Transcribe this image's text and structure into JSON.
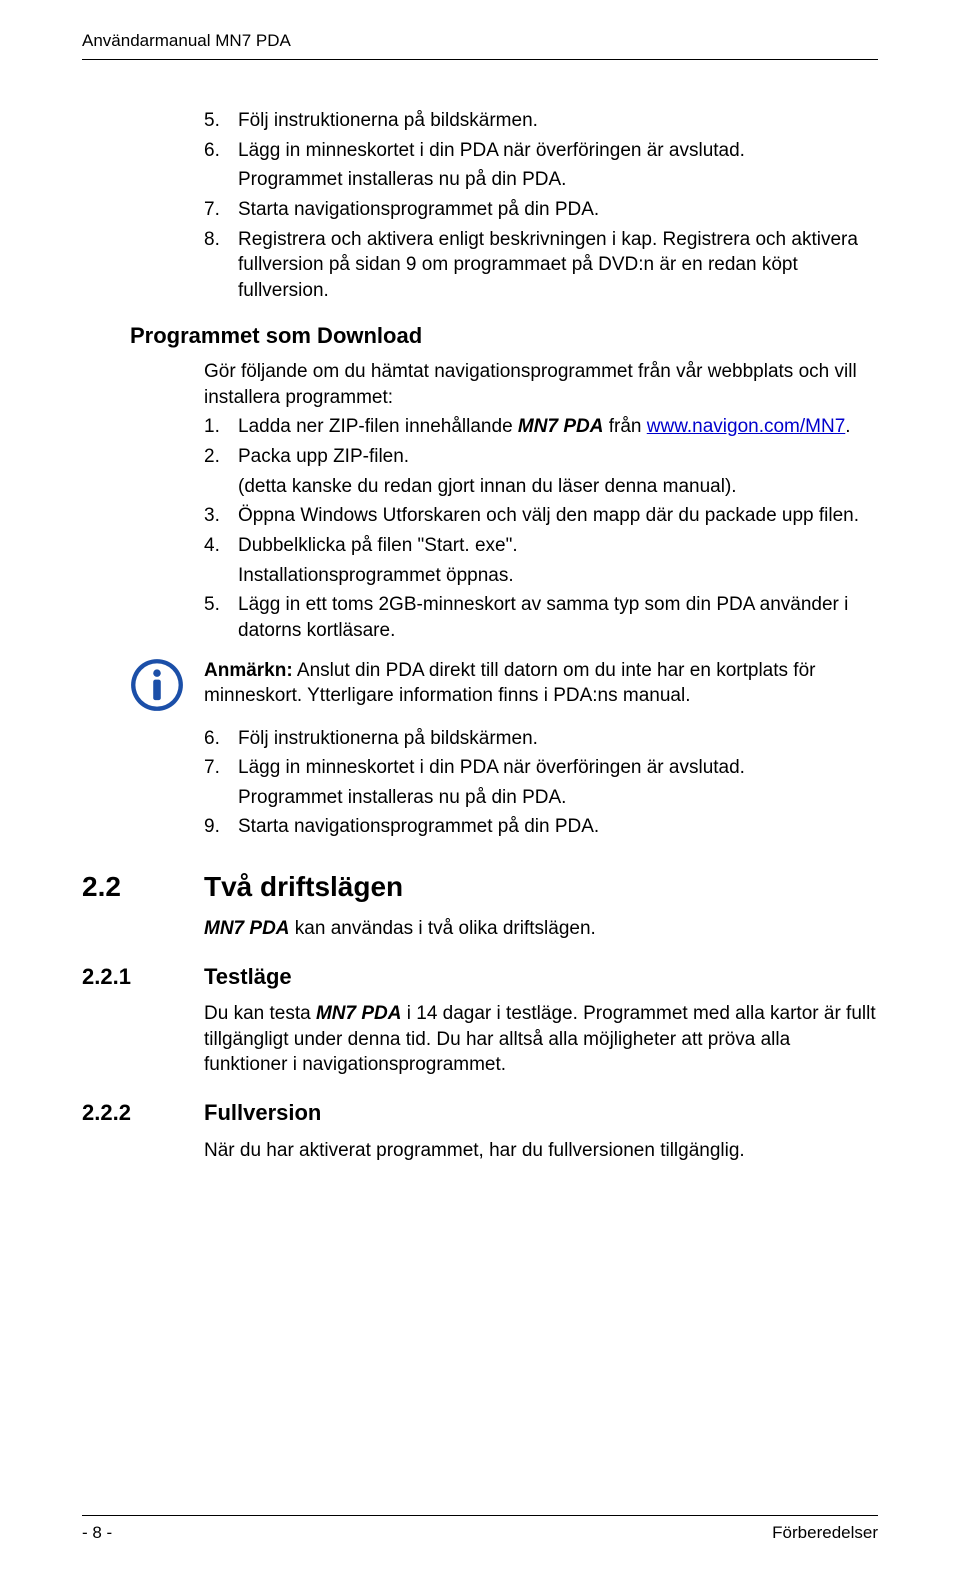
{
  "header": {
    "title": "Användarmanual MN7 PDA"
  },
  "list1": {
    "i5": {
      "n": "5.",
      "t": "Följ instruktionerna på bildskärmen."
    },
    "i6": {
      "n": "6.",
      "t": "Lägg in minneskortet i din PDA när överföringen är avslutad."
    },
    "i6b": "Programmet installeras nu på din PDA.",
    "i7": {
      "n": "7.",
      "t": "Starta navigationsprogrammet på din PDA."
    },
    "i8": {
      "n": "8.",
      "t": "Registrera och aktivera enligt beskrivningen i kap. Registrera och aktivera fullversion på sidan 9 om programmaet på DVD:n är en redan köpt fullversion."
    }
  },
  "download": {
    "heading": "Programmet som Download",
    "intro": "Gör följande om du hämtat navigationsprogrammet från vår webbplats och vill installera programmet:",
    "i1n": "1.",
    "i1a": "Ladda ner ZIP-filen innehållande ",
    "i1prod": "MN7 PDA",
    "i1b": " från ",
    "i1link": "www.navigon.com/MN7",
    "i1c": ".",
    "i2": {
      "n": "2.",
      "t": "Packa upp ZIP-filen."
    },
    "i2b": "(detta kanske du redan gjort innan du läser denna manual).",
    "i3": {
      "n": "3.",
      "t": "Öppna Windows Utforskaren och välj den mapp där du packade upp filen."
    },
    "i4": {
      "n": "4.",
      "t": "Dubbelklicka på filen \"Start. exe\"."
    },
    "i4b": "Installationsprogrammet öppnas.",
    "i5": {
      "n": "5.",
      "t": "Lägg in ett toms 2GB-minneskort av samma typ som din PDA använder i datorns kortläsare."
    }
  },
  "note": {
    "label": "Anmärkn:",
    "text": " Anslut din PDA direkt till datorn om du inte har en kortplats för minneskort. Ytterligare information finns i PDA:ns manual."
  },
  "list2": {
    "i6": {
      "n": "6.",
      "t": "Följ instruktionerna på bildskärmen."
    },
    "i7": {
      "n": "7.",
      "t": "Lägg in minneskortet i din PDA när överföringen är avslutad."
    },
    "i7b": "Programmet installeras nu på din PDA.",
    "i9": {
      "n": "9.",
      "t": "Starta navigationsprogrammet på din PDA."
    }
  },
  "sections": {
    "s22": {
      "num": "2.2",
      "title": "Två driftslägen"
    },
    "s22_a": "MN7 PDA",
    "s22_b": " kan användas i två olika driftslägen.",
    "s221": {
      "num": "2.2.1",
      "title": "Testläge"
    },
    "s221_a": "Du kan testa ",
    "s221_prod": "MN7 PDA",
    "s221_b": " i 14 dagar i testläge. Programmet med alla kartor är fullt tillgängligt under denna tid. Du har alltså alla möjligheter att pröva alla funktioner i navigationsprogrammet.",
    "s222": {
      "num": "2.2.2",
      "title": "Fullversion"
    },
    "s222_txt": "När du har aktiverat programmet, har du fullversionen tillgänglig."
  },
  "footer": {
    "left": "- 8 -",
    "right": "Förberedelser"
  }
}
